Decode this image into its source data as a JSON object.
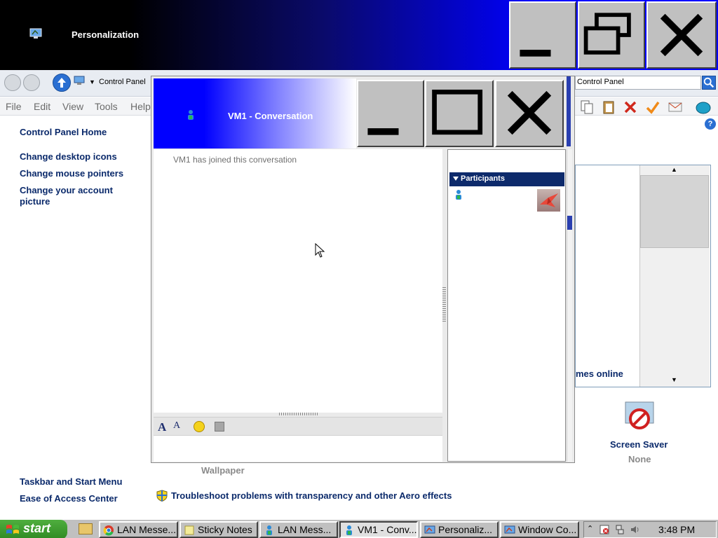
{
  "background_window": {
    "title": "Personalization",
    "address": "Control Panel",
    "search_value": "Control Panel",
    "menu": [
      "File",
      "Edit",
      "View",
      "Tools",
      "Help"
    ],
    "sidebar_top": [
      "Control Panel Home",
      "Change desktop icons",
      "Change mouse pointers",
      "Change your account picture"
    ],
    "sidebar_bottom": [
      "Taskbar and Start Menu",
      "Ease of Access Center"
    ],
    "help_glyph": "?",
    "list_fragment_text": "mes online",
    "screen_saver_label": "Screen Saver",
    "screen_saver_value": "None",
    "wallpaper_label": "Wallpaper",
    "aero_link": "Troubleshoot problems with transparency and other Aero effects",
    "scroll_up_glyph": "▲",
    "scroll_down_glyph": "▼",
    "address_arrow_glyph": "▼"
  },
  "conversation_window": {
    "title": "VM1 - Conversation",
    "chat_messages": [
      "VM1 has joined this conversation"
    ],
    "participants_header": "Participants",
    "format_font_glyph": "A",
    "format_color_glyph": "A"
  },
  "taskbar": {
    "start_label": "start",
    "tasks": [
      {
        "label": "LAN Messe...",
        "icon": "chrome-icon",
        "active": false
      },
      {
        "label": "Sticky Notes",
        "icon": "sticky-notes-icon",
        "active": false
      },
      {
        "label": "LAN Mess...",
        "icon": "lan-messenger-icon",
        "active": false
      },
      {
        "label": "VM1 - Conv...",
        "icon": "lan-messenger-icon",
        "active": true
      },
      {
        "label": "Personaliz...",
        "icon": "control-panel-icon",
        "active": false
      },
      {
        "label": "Window Co...",
        "icon": "control-panel-icon",
        "active": false
      }
    ],
    "tray_chevron": "⌃",
    "clock": "3:48 PM"
  },
  "colors": {
    "title_blue": "#0000ff",
    "link_navy": "#0b2a6b",
    "participants_header_bg": "#0d2a6b",
    "taskbar_gray": "#c0c0c0",
    "start_green": "#2f8a22"
  }
}
